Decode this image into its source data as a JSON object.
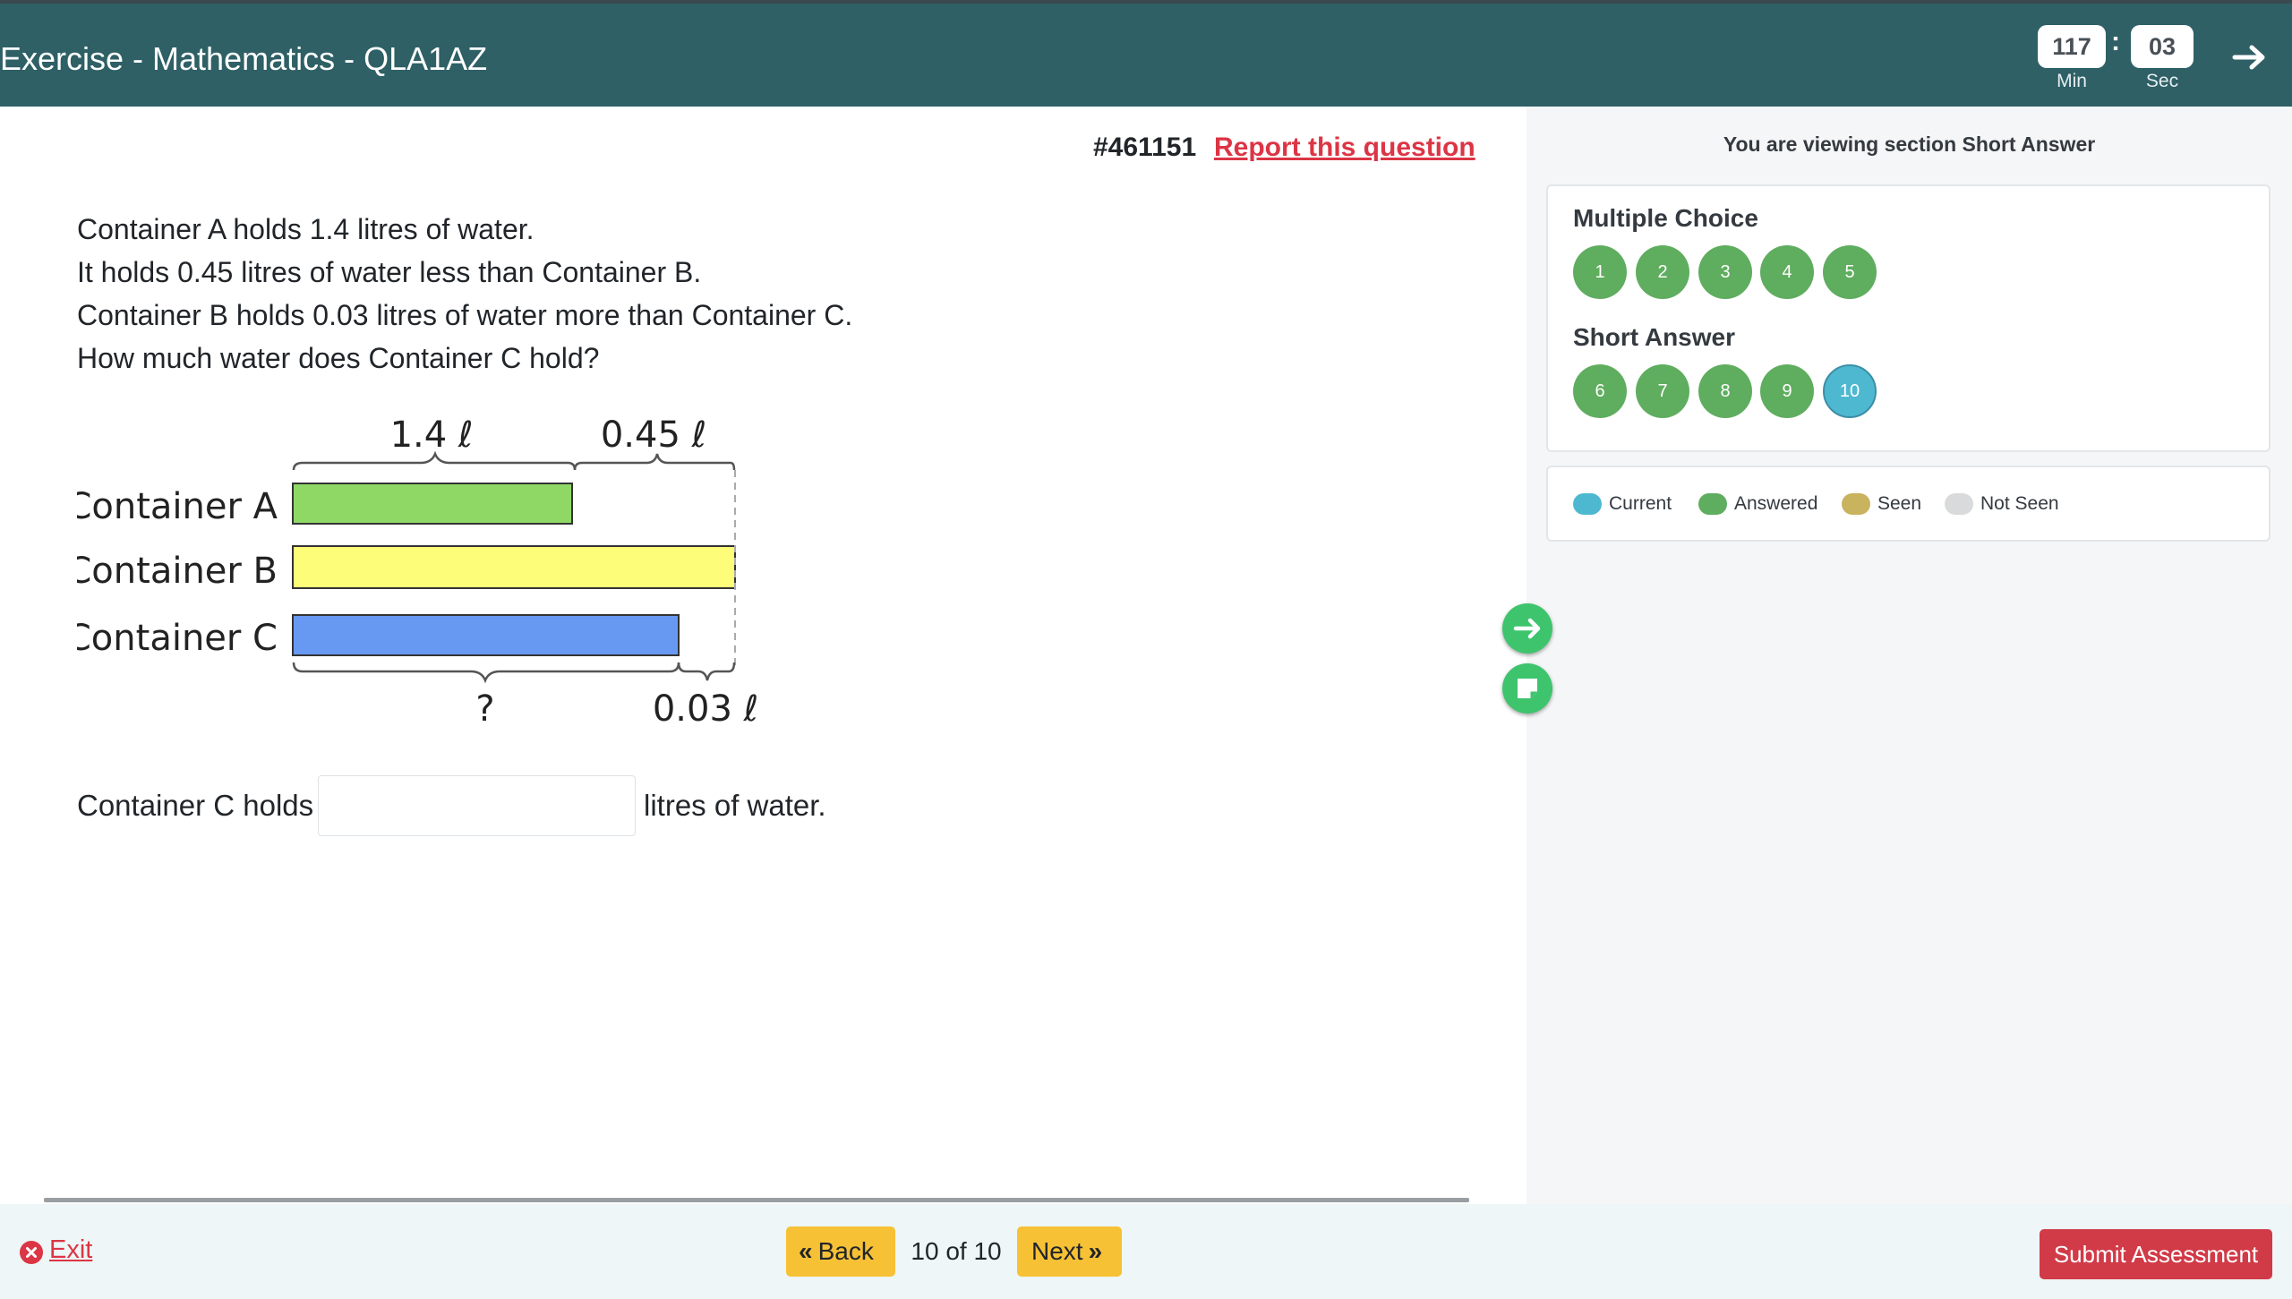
{
  "header": {
    "title": "Exercise - Mathematics - QLA1AZ",
    "timer": {
      "minutes": "117",
      "seconds": "03",
      "min_label": "Min",
      "sec_label": "Sec",
      "separator": ":"
    },
    "next_icon": "arrow-right-icon"
  },
  "question": {
    "id": "#461151",
    "report_label": "Report this question",
    "lines": [
      "Container A holds 1.4 litres of water.",
      "It holds 0.45 litres of water less than Container B.",
      "Container B holds 0.03 litres of water more than Container C.",
      "How much water does Container C hold?"
    ],
    "diagram": {
      "label_a": "Container A",
      "label_b": "Container B",
      "label_c": "Container C",
      "top_left_value": "1.4 ℓ",
      "top_right_value": "0.45 ℓ",
      "bottom_left_value": "?",
      "bottom_right_value": "0.03 ℓ",
      "colors": {
        "a": "#8fd866",
        "b": "#fdfd7a",
        "c": "#6899f2"
      }
    },
    "answer": {
      "prefix": "Container C holds",
      "value": "",
      "placeholder": "",
      "suffix": "litres of water."
    }
  },
  "sidebar": {
    "viewing_text": "You are viewing section Short Answer",
    "sections": [
      {
        "title": "Multiple Choice",
        "questions": [
          "1",
          "2",
          "3",
          "4",
          "5"
        ]
      },
      {
        "title": "Short Answer",
        "questions": [
          "6",
          "7",
          "8",
          "9",
          "10"
        ]
      }
    ],
    "current_question": "10",
    "legend": [
      {
        "label": "Current",
        "color": "#4fb8d1"
      },
      {
        "label": "Answered",
        "color": "#5fad5f"
      },
      {
        "label": "Seen",
        "color": "#c9b35f"
      },
      {
        "label": "Not Seen",
        "color": "#d8dadc"
      }
    ],
    "side_buttons": [
      "arrow-right-icon",
      "sticky-note-icon"
    ]
  },
  "footer": {
    "exit_label": "Exit",
    "back_label": "Back",
    "page_count": "10 of 10",
    "next_label": "Next",
    "submit_label": "Submit Assessment"
  }
}
